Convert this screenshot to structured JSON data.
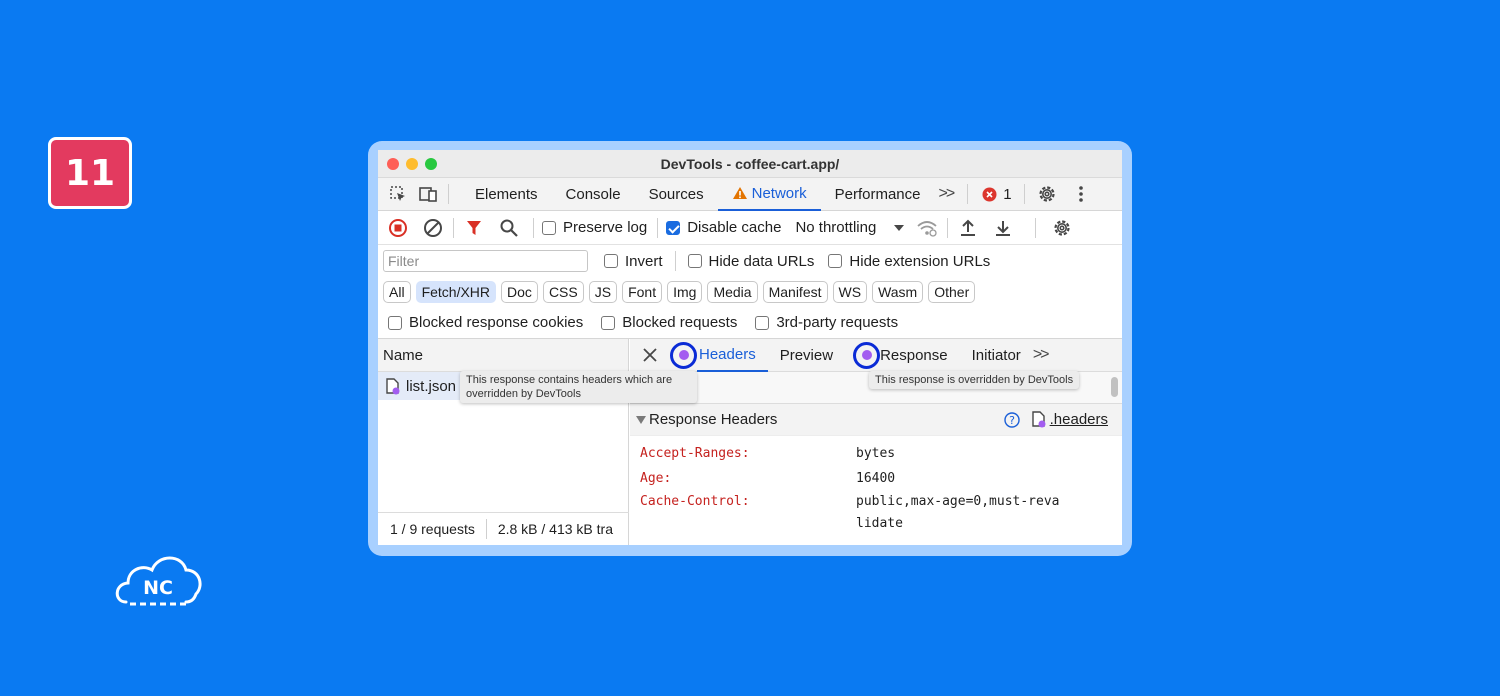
{
  "step_badge": "11",
  "logo_text": "NC",
  "window": {
    "title": "DevTools - coffee-cart.app/"
  },
  "tabs": {
    "items": [
      "Elements",
      "Console",
      "Sources",
      "Network",
      "Performance"
    ],
    "active": "Network",
    "more": ">>",
    "error_count": "1"
  },
  "toolbar": {
    "preserve_log": "Preserve log",
    "disable_cache": "Disable cache",
    "throttling": "No throttling"
  },
  "filter": {
    "placeholder": "Filter",
    "invert": "Invert",
    "hide_data_urls": "Hide data URLs",
    "hide_extension_urls": "Hide extension URLs"
  },
  "types": [
    "All",
    "Fetch/XHR",
    "Doc",
    "CSS",
    "JS",
    "Font",
    "Img",
    "Media",
    "Manifest",
    "WS",
    "Wasm",
    "Other"
  ],
  "types_selected": "Fetch/XHR",
  "blocked": {
    "cookies": "Blocked response cookies",
    "requests": "Blocked requests",
    "third_party": "3rd-party requests"
  },
  "requests": {
    "column": "Name",
    "items": [
      {
        "name": "list.json"
      }
    ],
    "status_count": "1 / 9 requests",
    "status_size": "2.8 kB / 413 kB tra"
  },
  "detail": {
    "tabs": [
      "Headers",
      "Preview",
      "Response",
      "Initiator"
    ],
    "active": "Headers",
    "more": ">>",
    "section": "Response Headers",
    "headers_link": ".headers",
    "headers": [
      {
        "key": "Accept-Ranges:",
        "value": "bytes"
      },
      {
        "key": "Age:",
        "value": "16400"
      },
      {
        "key": "Cache-Control:",
        "value": "public,max-age=0,must-revalidate"
      }
    ]
  },
  "tooltips": {
    "headers": "This response contains headers which are overridden by DevTools",
    "response": "This response is overridden by DevTools"
  },
  "colors": {
    "background": "#0a7af2",
    "badge": "#e33a5f",
    "accent": "#1a5fd8",
    "override_dot": "#a35df0",
    "highlight_ring": "#0a2bd6"
  }
}
